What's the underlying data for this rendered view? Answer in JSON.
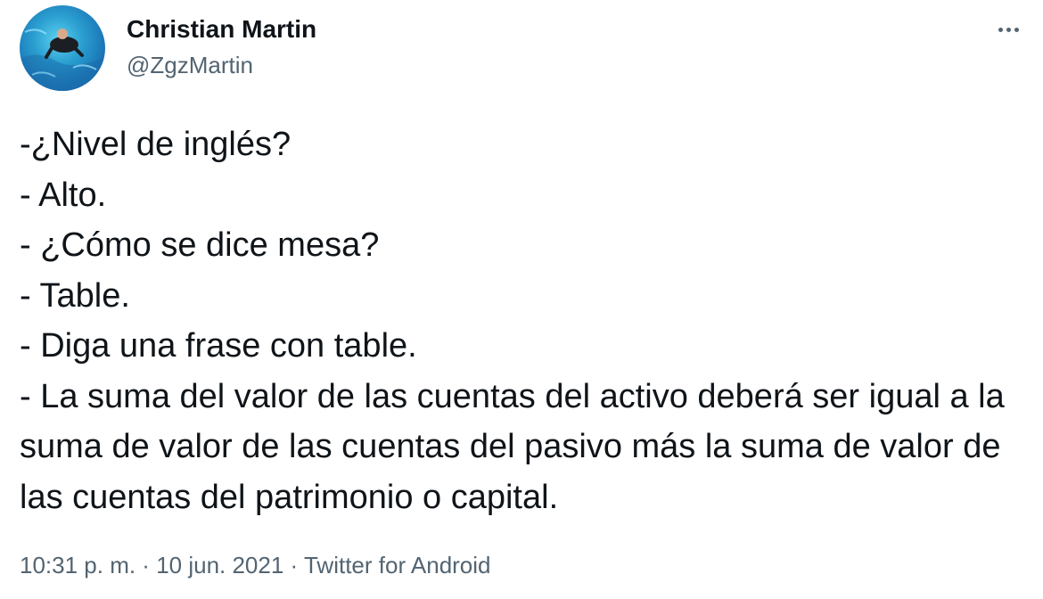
{
  "tweet": {
    "author": {
      "display_name": "Christian Martin",
      "handle": "@ZgzMartin"
    },
    "text": "-¿Nivel de inglés?\n- Alto.\n- ¿Cómo se dice mesa?\n- Table.\n- Diga una frase con table.\n- La suma del valor de las cuentas del activo deberá ser igual a la suma de valor de las cuentas del pasivo más la suma de valor de las cuentas del patrimonio o capital.",
    "time": "10:31 p. m.",
    "separator": " · ",
    "date": "10 jun. 2021",
    "source": "Twitter for Android"
  },
  "icons": {
    "more": "more-horizontal-icon",
    "avatar": "profile-photo"
  }
}
